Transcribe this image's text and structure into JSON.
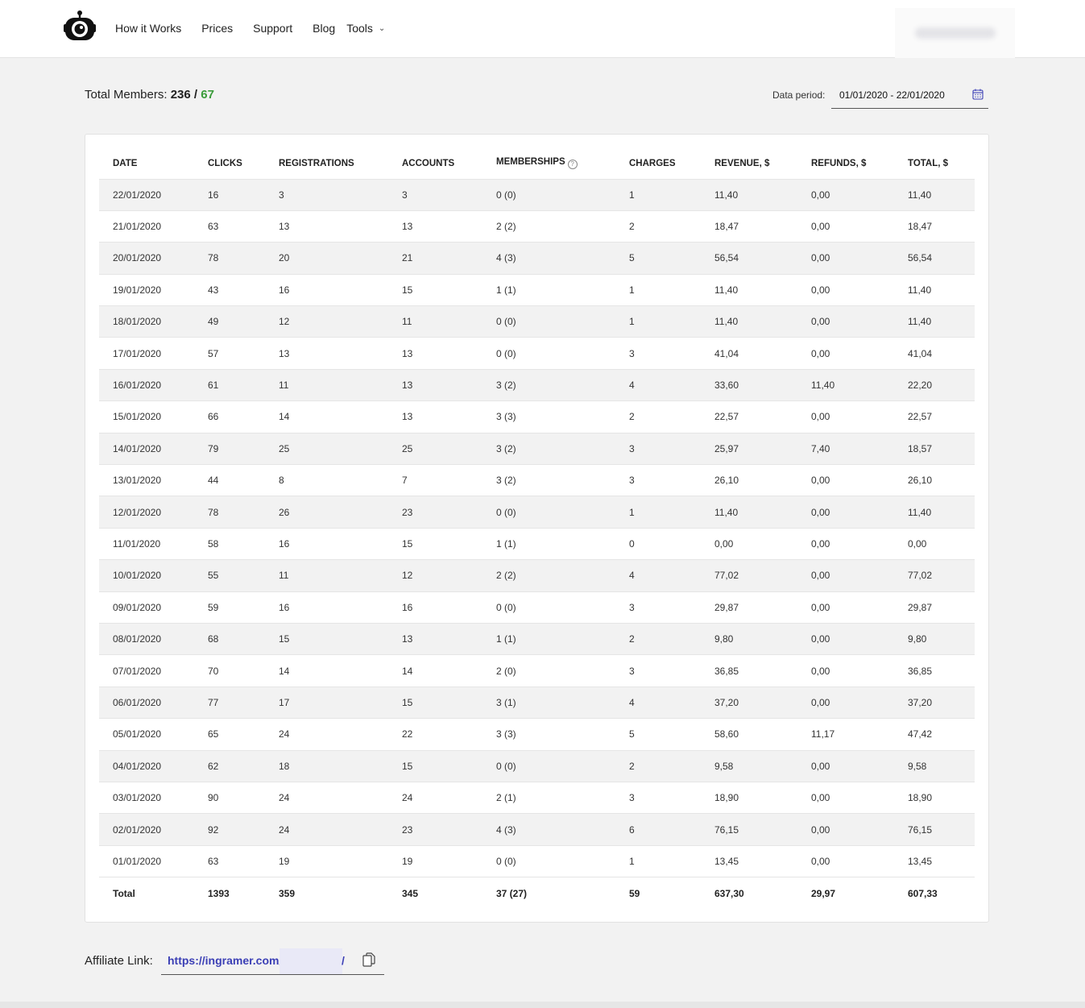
{
  "nav": {
    "items": [
      "How it Works",
      "Prices",
      "Support",
      "Blog"
    ],
    "tools_label": "Tools"
  },
  "summary": {
    "label": "Total Members:",
    "value_a": "236",
    "separator": "/",
    "value_b": "67"
  },
  "period": {
    "label": "Data period:",
    "value": "01/01/2020 - 22/01/2020"
  },
  "table": {
    "headers": [
      "DATE",
      "CLICKS",
      "REGISTRATIONS",
      "ACCOUNTS",
      "MEMBERSHIPS",
      "CHARGES",
      "REVENUE, $",
      "REFUNDS, $",
      "TOTAL, $"
    ],
    "rows": [
      [
        "22/01/2020",
        "16",
        "3",
        "3",
        "0 (0)",
        "1",
        "11,40",
        "0,00",
        "11,40"
      ],
      [
        "21/01/2020",
        "63",
        "13",
        "13",
        "2 (2)",
        "2",
        "18,47",
        "0,00",
        "18,47"
      ],
      [
        "20/01/2020",
        "78",
        "20",
        "21",
        "4 (3)",
        "5",
        "56,54",
        "0,00",
        "56,54"
      ],
      [
        "19/01/2020",
        "43",
        "16",
        "15",
        "1 (1)",
        "1",
        "11,40",
        "0,00",
        "11,40"
      ],
      [
        "18/01/2020",
        "49",
        "12",
        "11",
        "0 (0)",
        "1",
        "11,40",
        "0,00",
        "11,40"
      ],
      [
        "17/01/2020",
        "57",
        "13",
        "13",
        "0 (0)",
        "3",
        "41,04",
        "0,00",
        "41,04"
      ],
      [
        "16/01/2020",
        "61",
        "11",
        "13",
        "3 (2)",
        "4",
        "33,60",
        "11,40",
        "22,20"
      ],
      [
        "15/01/2020",
        "66",
        "14",
        "13",
        "3 (3)",
        "2",
        "22,57",
        "0,00",
        "22,57"
      ],
      [
        "14/01/2020",
        "79",
        "25",
        "25",
        "3 (2)",
        "3",
        "25,97",
        "7,40",
        "18,57"
      ],
      [
        "13/01/2020",
        "44",
        "8",
        "7",
        "3 (2)",
        "3",
        "26,10",
        "0,00",
        "26,10"
      ],
      [
        "12/01/2020",
        "78",
        "26",
        "23",
        "0 (0)",
        "1",
        "11,40",
        "0,00",
        "11,40"
      ],
      [
        "11/01/2020",
        "58",
        "16",
        "15",
        "1 (1)",
        "0",
        "0,00",
        "0,00",
        "0,00"
      ],
      [
        "10/01/2020",
        "55",
        "11",
        "12",
        "2 (2)",
        "4",
        "77,02",
        "0,00",
        "77,02"
      ],
      [
        "09/01/2020",
        "59",
        "16",
        "16",
        "0 (0)",
        "3",
        "29,87",
        "0,00",
        "29,87"
      ],
      [
        "08/01/2020",
        "68",
        "15",
        "13",
        "1 (1)",
        "2",
        "9,80",
        "0,00",
        "9,80"
      ],
      [
        "07/01/2020",
        "70",
        "14",
        "14",
        "2 (0)",
        "3",
        "36,85",
        "0,00",
        "36,85"
      ],
      [
        "06/01/2020",
        "77",
        "17",
        "15",
        "3 (1)",
        "4",
        "37,20",
        "0,00",
        "37,20"
      ],
      [
        "05/01/2020",
        "65",
        "24",
        "22",
        "3 (3)",
        "5",
        "58,60",
        "11,17",
        "47,42"
      ],
      [
        "04/01/2020",
        "62",
        "18",
        "15",
        "0 (0)",
        "2",
        "9,58",
        "0,00",
        "9,58"
      ],
      [
        "03/01/2020",
        "90",
        "24",
        "24",
        "2 (1)",
        "3",
        "18,90",
        "0,00",
        "18,90"
      ],
      [
        "02/01/2020",
        "92",
        "24",
        "23",
        "4 (3)",
        "6",
        "76,15",
        "0,00",
        "76,15"
      ],
      [
        "01/01/2020",
        "63",
        "19",
        "19",
        "0 (0)",
        "1",
        "13,45",
        "0,00",
        "13,45"
      ]
    ],
    "totals": [
      "Total",
      "1393",
      "359",
      "345",
      "37 (27)",
      "59",
      "637,30",
      "29,97",
      "607,33"
    ]
  },
  "affiliate": {
    "label": "Affiliate Link:",
    "link_start": "https://ingramer.com/",
    "link_end": "/"
  },
  "colors": {
    "accent_green": "#3a9b3a",
    "link_blue": "#3b3fb5"
  },
  "icons": [
    "robot-logo-icon",
    "chevron-down-icon",
    "calendar-icon",
    "help-circle-icon",
    "copy-icon"
  ]
}
